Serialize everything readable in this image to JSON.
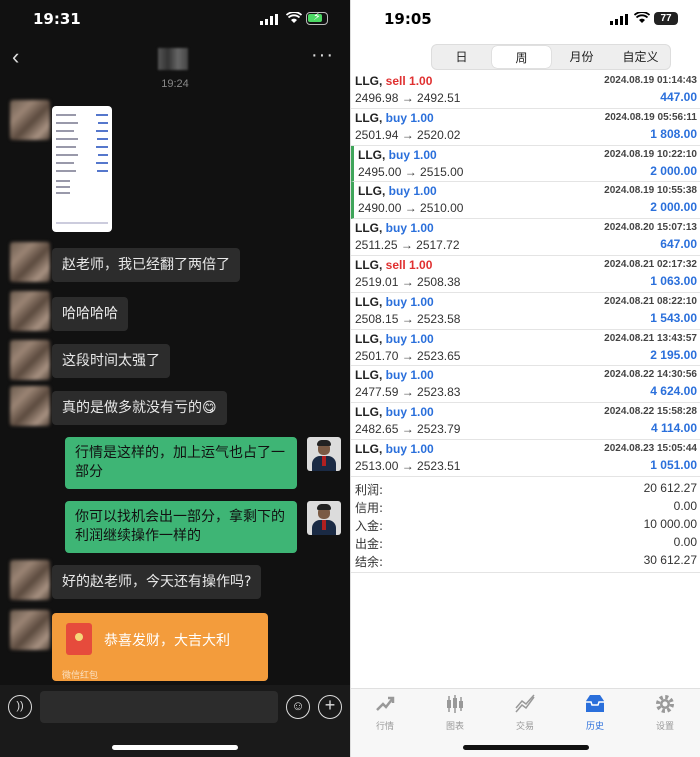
{
  "left": {
    "status_time": "19:31",
    "chat_timestamp": "19:24",
    "nav": {
      "back_icon": "chevron-left-icon",
      "more_icon": "more-icon"
    },
    "messages": [
      {
        "side": "left",
        "text": "赵老师，我已经翻了两倍了"
      },
      {
        "side": "left",
        "text": "哈哈哈哈"
      },
      {
        "side": "left",
        "text": "这段时间太强了"
      },
      {
        "side": "left",
        "text": "真的是做多就没有亏的😋"
      },
      {
        "side": "right",
        "text": "行情是这样的，加上运气也占了一部分"
      },
      {
        "side": "right",
        "text": "你可以找机会出一部分，拿剩下的利润继续操作一样的"
      },
      {
        "side": "left",
        "text": "好的赵老师，今天还有操作吗?"
      }
    ],
    "red_packet": {
      "title": "恭喜发财，大吉大利",
      "footer": "微信红包"
    }
  },
  "right": {
    "status_time": "19:05",
    "battery": "77",
    "segments": [
      "日",
      "周",
      "月份",
      "自定义"
    ],
    "active_segment": "周",
    "trades": [
      {
        "symbol": "LLG,",
        "side": "sell",
        "lots": "1.00",
        "date": "2024.08.19 01:14:43",
        "prices": "2496.98 → 2492.51",
        "profit": "447.00",
        "marked": false
      },
      {
        "symbol": "LLG,",
        "side": "buy",
        "lots": "1.00",
        "date": "2024.08.19 05:56:11",
        "prices": "2501.94 → 2520.02",
        "profit": "1 808.00",
        "marked": false
      },
      {
        "symbol": "LLG,",
        "side": "buy",
        "lots": "1.00",
        "date": "2024.08.19 10:22:10",
        "prices": "2495.00 → 2515.00",
        "profit": "2 000.00",
        "marked": true
      },
      {
        "symbol": "LLG,",
        "side": "buy",
        "lots": "1.00",
        "date": "2024.08.19 10:55:38",
        "prices": "2490.00 → 2510.00",
        "profit": "2 000.00",
        "marked": true
      },
      {
        "symbol": "LLG,",
        "side": "buy",
        "lots": "1.00",
        "date": "2024.08.20 15:07:13",
        "prices": "2511.25 → 2517.72",
        "profit": "647.00",
        "marked": false
      },
      {
        "symbol": "LLG,",
        "side": "sell",
        "lots": "1.00",
        "date": "2024.08.21 02:17:32",
        "prices": "2519.01 → 2508.38",
        "profit": "1 063.00",
        "marked": false
      },
      {
        "symbol": "LLG,",
        "side": "buy",
        "lots": "1.00",
        "date": "2024.08.21 08:22:10",
        "prices": "2508.15 → 2523.58",
        "profit": "1 543.00",
        "marked": false
      },
      {
        "symbol": "LLG,",
        "side": "buy",
        "lots": "1.00",
        "date": "2024.08.21 13:43:57",
        "prices": "2501.70 → 2523.65",
        "profit": "2 195.00",
        "marked": false
      },
      {
        "symbol": "LLG,",
        "side": "buy",
        "lots": "1.00",
        "date": "2024.08.22 14:30:56",
        "prices": "2477.59 → 2523.83",
        "profit": "4 624.00",
        "marked": false
      },
      {
        "symbol": "LLG,",
        "side": "buy",
        "lots": "1.00",
        "date": "2024.08.22 15:58:28",
        "prices": "2482.65 → 2523.79",
        "profit": "4 114.00",
        "marked": false
      },
      {
        "symbol": "LLG,",
        "side": "buy",
        "lots": "1.00",
        "date": "2024.08.23 15:05:44",
        "prices": "2513.00 → 2523.51",
        "profit": "1 051.00",
        "marked": false
      }
    ],
    "summary": [
      {
        "label": "利润:",
        "value": "20 612.27"
      },
      {
        "label": "信用:",
        "value": "0.00"
      },
      {
        "label": "入金:",
        "value": "10 000.00"
      },
      {
        "label": "出金:",
        "value": "0.00"
      },
      {
        "label": "结余:",
        "value": "30 612.27"
      }
    ],
    "tabs": [
      {
        "label": "行情",
        "icon": "quotes-icon"
      },
      {
        "label": "图表",
        "icon": "chart-icon"
      },
      {
        "label": "交易",
        "icon": "trade-icon"
      },
      {
        "label": "历史",
        "icon": "history-icon"
      },
      {
        "label": "设置",
        "icon": "settings-icon"
      }
    ],
    "active_tab": "历史",
    "colors": {
      "buy": "#2a6fdb",
      "sell": "#e03030",
      "profit": "#2a6fdb",
      "chat_bg": "#111111",
      "bubble_right": "#3eb575"
    }
  }
}
